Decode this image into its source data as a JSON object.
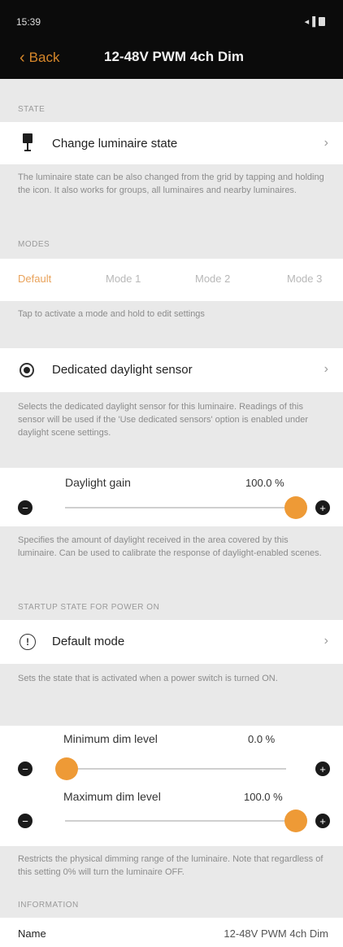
{
  "status": {
    "time": "15:39",
    "signal": "◂▐"
  },
  "nav": {
    "back_label": "Back",
    "title": "12-48V PWM 4ch Dim"
  },
  "sections": {
    "state": "STATE",
    "modes": "MODES",
    "startup": "STARTUP STATE FOR POWER ON",
    "information": "INFORMATION"
  },
  "state_row": {
    "label": "Change luminaire state",
    "icon": "lamp-icon"
  },
  "state_desc": "The luminaire state can be also changed from the grid by tapping and holding the icon. It also works for groups, all luminaires and nearby luminaires.",
  "modes": {
    "items": [
      "Default",
      "Mode 1",
      "Mode 2",
      "Mode 3"
    ],
    "active_index": 0,
    "desc": "Tap to activate a mode and hold to edit settings"
  },
  "daylight_row": {
    "label": "Dedicated daylight sensor",
    "icon": "sensor-icon"
  },
  "daylight_desc": "Selects the dedicated daylight sensor for this luminaire. Readings of this sensor will be used if the 'Use dedicated sensors' option is enabled under daylight scene settings.",
  "daylight_gain": {
    "label": "Daylight gain",
    "value_text": "100.0 %",
    "level": 1.0
  },
  "daylight_gain_desc": "Specifies the amount of daylight received in the area covered by this luminaire. Can be used to calibrate the response of daylight-enabled scenes.",
  "default_mode_row": {
    "label": "Default mode",
    "icon": "info-icon"
  },
  "default_mode_desc": "Sets the state that is activated when a power switch is turned ON.",
  "min_dim": {
    "label": "Minimum dim level",
    "value_text": "0.0 %",
    "level": 0.0
  },
  "max_dim": {
    "label": "Maximum dim level",
    "value_text": "100.0 %",
    "level": 1.0
  },
  "dim_desc": "Restricts the physical dimming range of the luminaire. Note that regardless of this setting 0% will turn the luminaire OFF.",
  "info": {
    "name_label": "Name",
    "name_value": "12-48V PWM 4ch Dim"
  },
  "colors": {
    "accent": "#ee9a36",
    "background": "#e9e9e9",
    "topbar": "#0b0b0b"
  }
}
